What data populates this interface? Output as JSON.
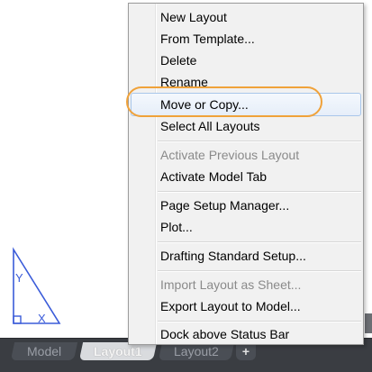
{
  "menu": {
    "items": [
      {
        "label": "New Layout",
        "enabled": true
      },
      {
        "label": "From Template...",
        "enabled": true
      },
      {
        "label": "Delete",
        "enabled": true
      },
      {
        "label": "Rename",
        "enabled": true
      },
      {
        "label": "Move or Copy...",
        "enabled": true,
        "highlighted": true
      },
      {
        "label": "Select All Layouts",
        "enabled": true
      },
      {
        "label": "Activate Previous Layout",
        "enabled": false
      },
      {
        "label": "Activate Model Tab",
        "enabled": true
      },
      {
        "label": "Page Setup Manager...",
        "enabled": true
      },
      {
        "label": "Plot...",
        "enabled": true
      },
      {
        "label": "Drafting Standard Setup...",
        "enabled": true
      },
      {
        "label": "Import Layout as Sheet...",
        "enabled": false
      },
      {
        "label": "Export Layout to Model...",
        "enabled": true
      },
      {
        "label": "Dock above Status Bar",
        "enabled": true
      }
    ]
  },
  "tabs": [
    {
      "label": "Model",
      "active": false
    },
    {
      "label": "Layout1",
      "active": true
    },
    {
      "label": "Layout2",
      "active": false
    }
  ],
  "add_tab_label": "+",
  "ucs": {
    "y_label": "Y",
    "x_label": "X"
  },
  "colors": {
    "highlight_ring": "#f0a23a",
    "ucs": "#3a5bd9"
  }
}
